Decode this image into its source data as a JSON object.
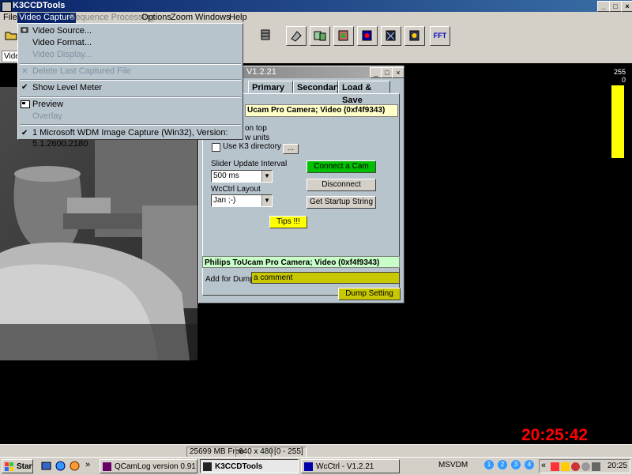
{
  "window": {
    "title": "K3CCDTools"
  },
  "menubar": {
    "items": [
      {
        "label": "File"
      },
      {
        "label": "Video Capture"
      },
      {
        "label": "Sequence Processing"
      },
      {
        "label": "Options"
      },
      {
        "label": "Zoom"
      },
      {
        "label": "Windows"
      },
      {
        "label": "Help"
      }
    ]
  },
  "toolbar": {
    "fft_label": "FFT",
    "sub_label": "Vide"
  },
  "video_capture_menu": {
    "items": [
      {
        "label": "Video Source..."
      },
      {
        "label": "Video Format..."
      },
      {
        "label": "Video Display..."
      },
      {
        "label": "Delete Last Captured File"
      },
      {
        "label": "Show Level Meter"
      },
      {
        "label": "Preview"
      },
      {
        "label": "Overlay"
      },
      {
        "label": "1 Microsoft WDM Image Capture (Win32), Version:  5.1.2600.2180"
      }
    ]
  },
  "level_meter": {
    "max": "255",
    "min": "0",
    "level": 1.0,
    "color": "#ffff00"
  },
  "wcctrl": {
    "title_fragment": "V1.2.21",
    "tabs": [
      {
        "label": "Primary"
      },
      {
        "label": "Secondary"
      },
      {
        "label": "Load & Save"
      }
    ],
    "camera_name_top": "Ucam Pro Camera; Video (0xf4f9343)",
    "option_on_top": "on top",
    "option_raw_units": "w units",
    "use_k3_directory": "Use K3 directory",
    "browse_label": "...",
    "connect_label": "Connect a Cam",
    "disconnect_label": "Disconnect",
    "startup_label": "Get Startup String",
    "slider_interval_label": "Slider Update Interval",
    "slider_interval_value": "500 ms",
    "layout_label": "WcCtrl Layout",
    "layout_value": "Jan ;-)",
    "tips_label": "Tips !!!",
    "camera_name_bottom": "Philips ToUcam Pro Camera; Video (0xf4f9343)",
    "dump_label": "Add for Dump:",
    "dump_value": "a comment",
    "dump_button": "Dump Setting"
  },
  "statusbar": {
    "free": "25699 MB Free",
    "size": "640 x 480",
    "range": "[0 - 255]"
  },
  "overlay_clock": "20:25:42",
  "taskbar": {
    "start_label": "Start",
    "chevron": "»",
    "tasks": [
      {
        "label": "QCamLog version 0.91 (B..."
      },
      {
        "label": "K3CCDTools"
      },
      {
        "label": "WcCtrl - V1.2.21"
      }
    ],
    "msvdm": "MSVDM",
    "desktops": [
      "1",
      "2",
      "3",
      "4"
    ],
    "tray_chevron": "«",
    "clock": "20:25"
  },
  "colors": {
    "titlebar": "#0a246a",
    "connect": "#00c000",
    "tips": "#ffff00",
    "dump": "#c8c800",
    "cam_top_bg": "#ffffc8",
    "cam_bottom_bg": "#c8ffc8"
  }
}
